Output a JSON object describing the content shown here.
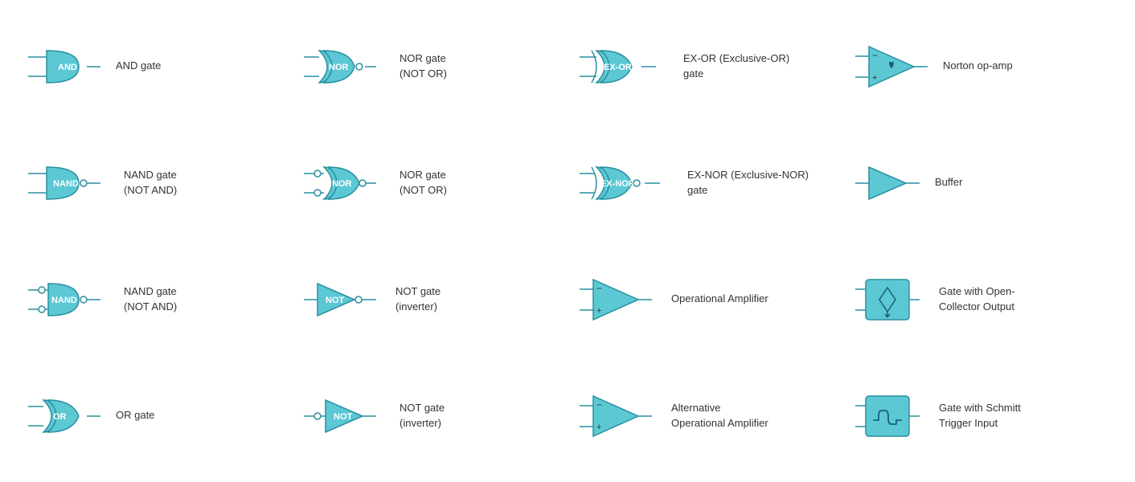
{
  "cells": [
    {
      "id": "and-gate",
      "label": "AND gate",
      "type": "AND"
    },
    {
      "id": "nor-gate-1",
      "label": "NOR gate\n(NOT OR)",
      "type": "NOR"
    },
    {
      "id": "ex-or-gate",
      "label": "EX-OR (Exclusive-OR)\ngate",
      "type": "EXOR"
    },
    {
      "id": "norton-op-amp",
      "label": "Norton op-amp",
      "type": "NORTON"
    },
    {
      "id": "nand-gate-1",
      "label": "NAND gate\n(NOT AND)",
      "type": "NAND"
    },
    {
      "id": "nor-gate-2",
      "label": "NOR gate\n(NOT OR)",
      "type": "NOR2"
    },
    {
      "id": "ex-nor-gate",
      "label": "EX-NOR (Exclusive-NOR)\ngate",
      "type": "EXNOR"
    },
    {
      "id": "buffer",
      "label": "Buffer",
      "type": "BUFFER"
    },
    {
      "id": "nand-gate-2",
      "label": "NAND gate\n(NOT AND)",
      "type": "NAND2"
    },
    {
      "id": "not-gate-1",
      "label": "NOT gate\n(inverter)",
      "type": "NOT1"
    },
    {
      "id": "op-amp",
      "label": "Operational Amplifier",
      "type": "OPAMP"
    },
    {
      "id": "gate-open-collector",
      "label": "Gate with Open-\nCollector Output",
      "type": "OPENCOLLECTOR"
    },
    {
      "id": "or-gate",
      "label": "OR gate",
      "type": "OR"
    },
    {
      "id": "not-gate-2",
      "label": "NOT gate\n(inverter)",
      "type": "NOT2"
    },
    {
      "id": "alt-op-amp",
      "label": "Alternative\nOperational Amplifier",
      "type": "ALTOPAMP"
    },
    {
      "id": "schmitt-trigger",
      "label": "Gate with Schmitt\nTrigger Input",
      "type": "SCHMITT"
    }
  ]
}
